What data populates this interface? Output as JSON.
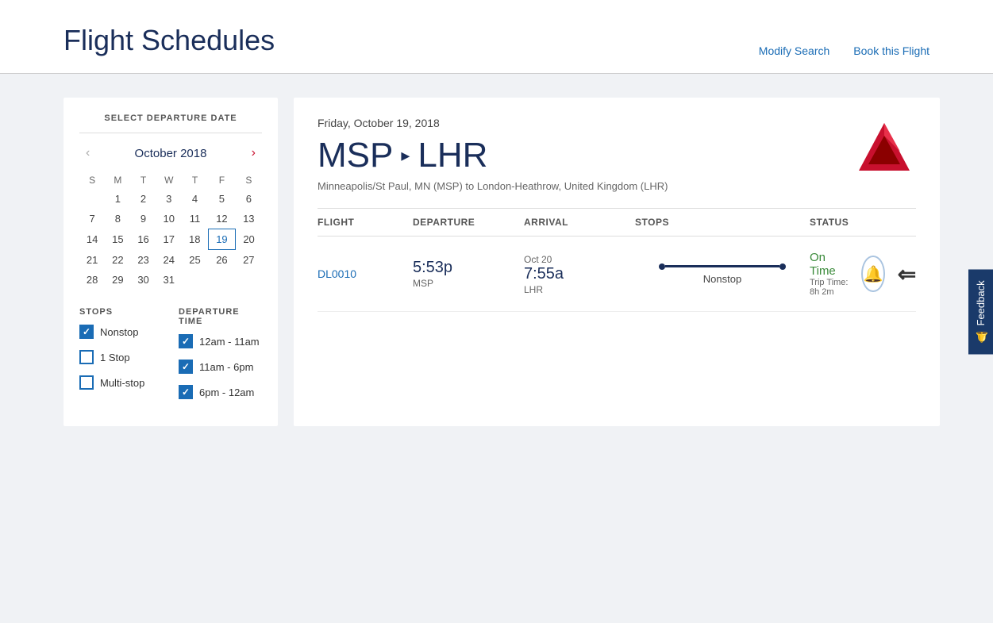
{
  "header": {
    "title": "Flight Schedules",
    "modify_search": "Modify Search",
    "book_flight": "Book this Flight"
  },
  "sidebar": {
    "calendar_title": "SELECT DEPARTURE DATE",
    "month_year": "October 2018",
    "days_of_week": [
      "S",
      "M",
      "T",
      "W",
      "T",
      "F",
      "S"
    ],
    "weeks": [
      [
        "",
        "",
        "",
        "",
        "1",
        "2",
        "3",
        "4",
        "5",
        "6"
      ],
      [
        "7",
        "8",
        "9",
        "10",
        "11",
        "12",
        "13"
      ],
      [
        "14",
        "15",
        "16",
        "17",
        "18",
        "19",
        "20"
      ],
      [
        "21",
        "22",
        "23",
        "24",
        "25",
        "26",
        "27"
      ],
      [
        "28",
        "29",
        "30",
        "31",
        "",
        "",
        ""
      ]
    ],
    "today_date": "19",
    "filters": {
      "stops_label": "STOPS",
      "departure_label": "DEPARTURE TIME",
      "stops_items": [
        {
          "label": "Nonstop",
          "checked": true
        },
        {
          "label": "1 Stop",
          "checked": false
        },
        {
          "label": "Multi-stop",
          "checked": false
        }
      ],
      "departure_items": [
        {
          "label": "12am - 11am",
          "checked": true
        },
        {
          "label": "11am - 6pm",
          "checked": true
        },
        {
          "label": "6pm - 12am",
          "checked": true
        }
      ]
    }
  },
  "flight": {
    "date": "Friday, October 19, 2018",
    "origin_code": "MSP",
    "arrow": "▸",
    "dest_code": "LHR",
    "route_detail": "Minneapolis/St Paul, MN (MSP) to London-Heathrow, United Kingdom (LHR)",
    "table_headers": {
      "flight": "FLIGHT",
      "departure": "DEPARTURE",
      "arrival": "ARRIVAL",
      "stops": "STOPS",
      "status": "STATUS"
    },
    "rows": [
      {
        "flight_number": "DL0010",
        "departure_time": "5:53p",
        "departure_airport": "MSP",
        "arrival_date": "Oct 20",
        "arrival_time": "7:55a",
        "arrival_airport": "LHR",
        "stops": "Nonstop",
        "status": "On Time",
        "trip_time": "Trip Time: 8h 2m"
      }
    ]
  },
  "feedback": {
    "label": "Feedback",
    "icon": "🔔"
  }
}
